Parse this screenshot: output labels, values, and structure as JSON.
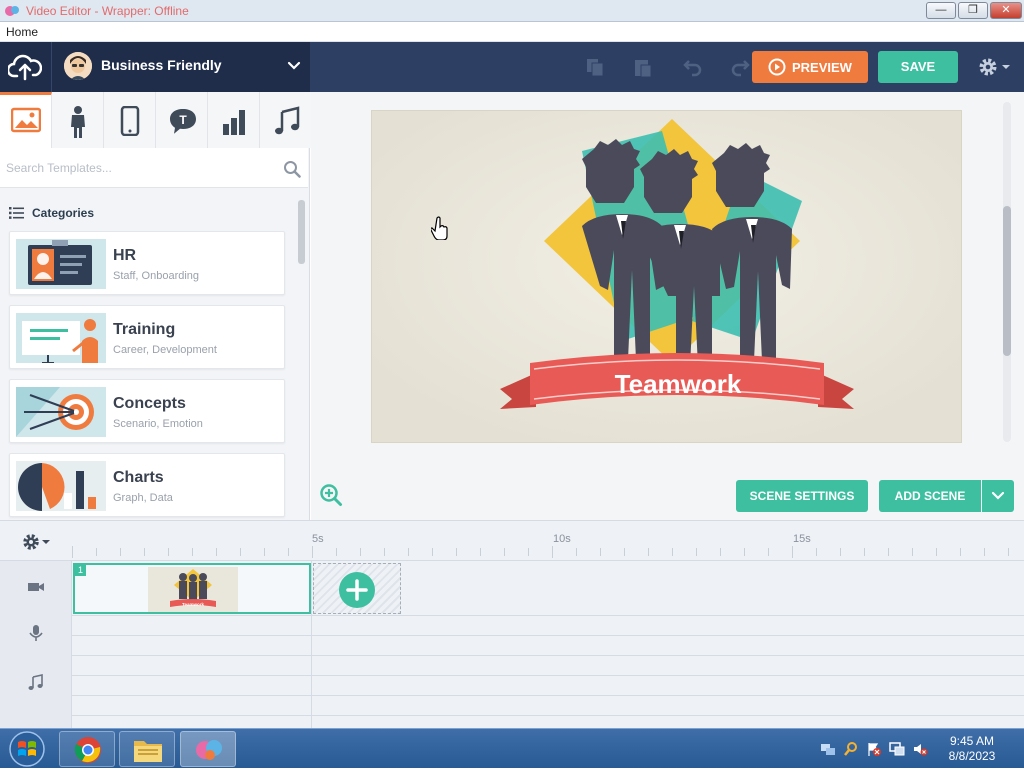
{
  "window": {
    "title": "Video Editor - Wrapper: Offline"
  },
  "menu": {
    "items": [
      "Home"
    ]
  },
  "header": {
    "theme_name": "Business Friendly",
    "preview_label": "PREVIEW",
    "save_label": "SAVE"
  },
  "library": {
    "tabs": [
      {
        "name": "backgrounds",
        "icon": "image-icon"
      },
      {
        "name": "characters",
        "icon": "person-icon"
      },
      {
        "name": "props",
        "icon": "phone-icon"
      },
      {
        "name": "text",
        "icon": "speech-bubble-icon"
      },
      {
        "name": "charts",
        "icon": "bar-chart-icon"
      },
      {
        "name": "audio",
        "icon": "music-note-icon"
      }
    ],
    "search_placeholder": "Search Templates...",
    "categories_label": "Categories",
    "categories": [
      {
        "title": "HR",
        "subtitle": "Staff, Onboarding"
      },
      {
        "title": "Training",
        "subtitle": "Career, Development"
      },
      {
        "title": "Concepts",
        "subtitle": "Scenario, Emotion"
      },
      {
        "title": "Charts",
        "subtitle": "Graph, Data"
      }
    ]
  },
  "stage": {
    "banner_text": "Teamwork",
    "scene_settings_label": "SCENE SETTINGS",
    "add_scene_label": "ADD SCENE"
  },
  "timeline": {
    "marks": [
      "5s",
      "10s",
      "15s"
    ],
    "scene_number": "1",
    "mini_banner": "Teamwork"
  },
  "taskbar": {
    "time": "9:45 AM",
    "date": "8/8/2023"
  },
  "colors": {
    "accent_orange": "#f07b3f",
    "accent_teal": "#3dbfa0",
    "header_navy": "#2d3f63"
  }
}
